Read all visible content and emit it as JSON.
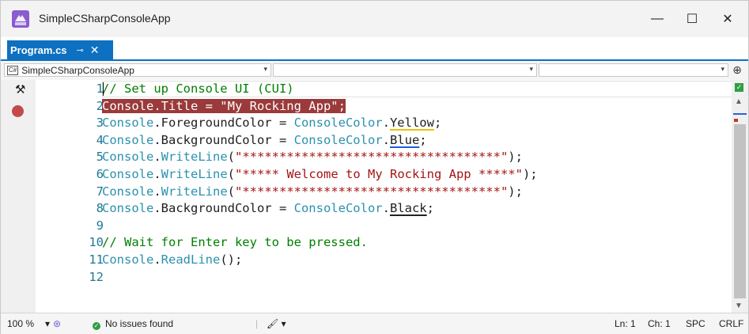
{
  "window": {
    "title": "SimpleCSharpConsoleApp",
    "minimize": "—",
    "maximize": "☐",
    "close": "✕"
  },
  "tab": {
    "label": "Program.cs",
    "pin": "⊸",
    "close": "✕",
    "overflow": "▾ ⚙"
  },
  "navbar": {
    "project": "SimpleCSharpConsoleApp",
    "project_badge": "C#",
    "type": "",
    "member": "",
    "dropdown": "▾",
    "split": "⊕"
  },
  "editor": {
    "lines": [
      {
        "num": "1",
        "tokens": [
          {
            "t": "// Set up Console UI (CUI)",
            "c": "c-comment"
          }
        ]
      },
      {
        "num": "2",
        "tokens": [
          {
            "t": "Console.Title = \"My Rocking App\";",
            "c": "c-hl"
          }
        ]
      },
      {
        "num": "3",
        "tokens": [
          {
            "t": "Console",
            "c": "c-type"
          },
          {
            "t": ".ForegroundColor = ",
            "c": ""
          },
          {
            "t": "ConsoleColor",
            "c": "c-type"
          },
          {
            "t": ".",
            "c": ""
          },
          {
            "t": "Yellow",
            "c": "sq-yellow"
          },
          {
            "t": ";",
            "c": ""
          }
        ]
      },
      {
        "num": "4",
        "tokens": [
          {
            "t": "Console",
            "c": "c-type"
          },
          {
            "t": ".BackgroundColor = ",
            "c": ""
          },
          {
            "t": "ConsoleColor",
            "c": "c-type"
          },
          {
            "t": ".",
            "c": ""
          },
          {
            "t": "Blue",
            "c": "sq-blue"
          },
          {
            "t": ";",
            "c": ""
          }
        ]
      },
      {
        "num": "5",
        "tokens": [
          {
            "t": "Console",
            "c": "c-type"
          },
          {
            "t": ".",
            "c": ""
          },
          {
            "t": "WriteLine",
            "c": "c-type"
          },
          {
            "t": "(",
            "c": ""
          },
          {
            "t": "\"***********************************\"",
            "c": "c-str"
          },
          {
            "t": ");",
            "c": ""
          }
        ]
      },
      {
        "num": "6",
        "tokens": [
          {
            "t": "Console",
            "c": "c-type"
          },
          {
            "t": ".",
            "c": ""
          },
          {
            "t": "WriteLine",
            "c": "c-type"
          },
          {
            "t": "(",
            "c": ""
          },
          {
            "t": "\"***** Welcome to My Rocking App *****\"",
            "c": "c-str"
          },
          {
            "t": ");",
            "c": ""
          }
        ]
      },
      {
        "num": "7",
        "tokens": [
          {
            "t": "Console",
            "c": "c-type"
          },
          {
            "t": ".",
            "c": ""
          },
          {
            "t": "WriteLine",
            "c": "c-type"
          },
          {
            "t": "(",
            "c": ""
          },
          {
            "t": "\"***********************************\"",
            "c": "c-str"
          },
          {
            "t": ");",
            "c": ""
          }
        ]
      },
      {
        "num": "8",
        "tokens": [
          {
            "t": "Console",
            "c": "c-type"
          },
          {
            "t": ".BackgroundColor = ",
            "c": ""
          },
          {
            "t": "ConsoleColor",
            "c": "c-type"
          },
          {
            "t": ".",
            "c": ""
          },
          {
            "t": "Black",
            "c": "sq-black"
          },
          {
            "t": ";",
            "c": ""
          }
        ]
      },
      {
        "num": "9",
        "tokens": []
      },
      {
        "num": "10",
        "tokens": [
          {
            "t": "// Wait for Enter key to be pressed.",
            "c": "c-comment"
          }
        ]
      },
      {
        "num": "11",
        "tokens": [
          {
            "t": "Console",
            "c": "c-type"
          },
          {
            "t": ".",
            "c": ""
          },
          {
            "t": "ReadLine",
            "c": "c-type"
          },
          {
            "t": "();",
            "c": ""
          }
        ]
      },
      {
        "num": "12",
        "tokens": []
      }
    ]
  },
  "status": {
    "zoom": "100 %",
    "zoom_dropdown": "▾",
    "issues": "No issues found",
    "cleanup": "🖌 ▾",
    "line": "Ln: 1",
    "col": "Ch: 1",
    "spacing": "SPC",
    "line_ending": "CRLF"
  },
  "colors": {
    "accent": "#0e70c0",
    "breakpoint": "#c44a4a",
    "highlight": "#9a3a3a",
    "comment": "#008000",
    "type": "#2b91af",
    "string": "#a31515",
    "line_number": "#237893"
  },
  "icons": [
    "visual-studio-icon",
    "hammer-icon",
    "breakpoint-icon",
    "check-icon",
    "pin-icon",
    "close-icon",
    "brush-icon"
  ]
}
